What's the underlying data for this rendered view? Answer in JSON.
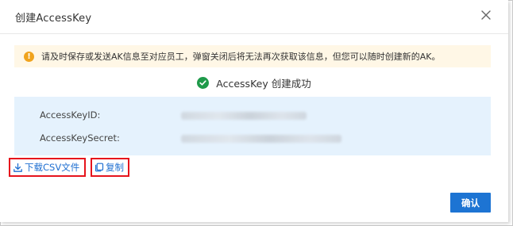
{
  "dialog": {
    "title": "创建AccessKey",
    "close_icon": "close-icon"
  },
  "alert": {
    "icon": "warning-icon",
    "icon_glyph": "!",
    "text": "请及时保存或发送AK信息至对应员工，弹窗关闭后将无法再次获取该信息，但您可以随时创建新的AK。",
    "color": "#f0a31d"
  },
  "success": {
    "icon": "check-circle-icon",
    "text": "AccessKey 创建成功",
    "color": "#1f9a4a"
  },
  "credentials": {
    "id_label": "AccessKeyID:",
    "secret_label": "AccessKeySecret:"
  },
  "actions": {
    "download_icon": "download-icon",
    "download_label": "下载CSV文件",
    "copy_icon": "copy-icon",
    "copy_label": "复制",
    "highlight_color": "#e6141c"
  },
  "footer": {
    "confirm_label": "确认",
    "accent": "#1d74d3"
  }
}
